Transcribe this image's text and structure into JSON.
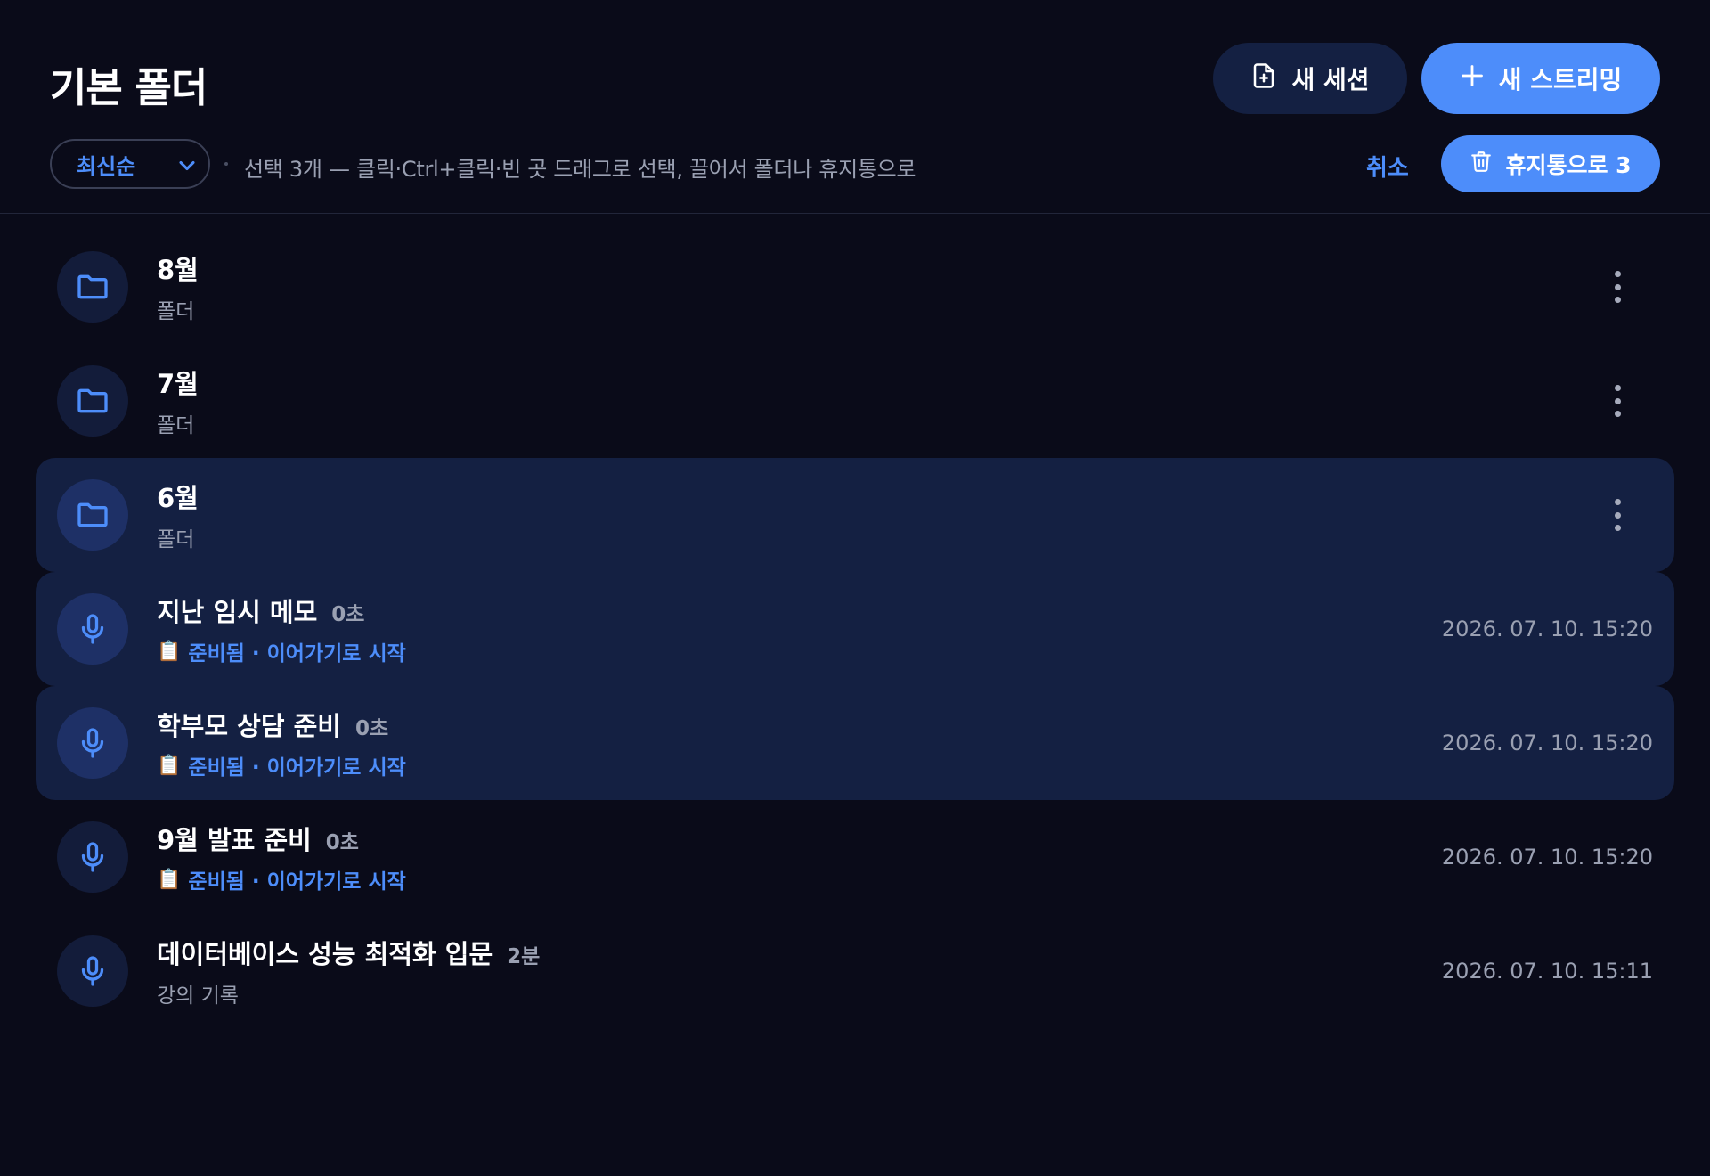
{
  "header": {
    "title": "기본 폴더",
    "new_session_label": "새 세션",
    "new_stream_label": "새 스트리밍"
  },
  "toolbar": {
    "sort_value": "최신순",
    "help_text": "선택 3개 — 클릭·Ctrl+클릭·빈 곳 드래그로 선택, 끌어서 폴더나 휴지통으로",
    "cancel_label": "취소",
    "trash_label": "휴지통으로 3"
  },
  "folders": [
    {
      "title": "8월",
      "subtitle": "폴더",
      "selected": false
    },
    {
      "title": "7월",
      "subtitle": "폴더",
      "selected": false
    },
    {
      "title": "6월",
      "subtitle": "폴더",
      "selected": true
    }
  ],
  "sessions": [
    {
      "title": "지난 임시 메모",
      "duration": "0초",
      "subtitle": "준비됨 · 이어가기로 시작",
      "status": true,
      "date": "2026. 07. 10. 15:20",
      "selected": true
    },
    {
      "title": "학부모 상담 준비",
      "duration": "0초",
      "subtitle": "준비됨 · 이어가기로 시작",
      "status": true,
      "date": "2026. 07. 10. 15:20",
      "selected": true
    },
    {
      "title": "9월 발표 준비",
      "duration": "0초",
      "subtitle": "준비됨 · 이어가기로 시작",
      "status": true,
      "date": "2026. 07. 10. 15:20",
      "selected": false
    },
    {
      "title": "데이터베이스 성능 최적화 입문",
      "duration": "2분",
      "subtitle": "강의 기록",
      "status": false,
      "date": "2026. 07. 10. 15:11",
      "selected": false
    }
  ],
  "colors": {
    "background": "#0a0b19",
    "accent": "#4d8dfa",
    "selected_row": "#142042",
    "muted_text": "#9aa0b2"
  },
  "icons": {
    "new_session": "file-plus-icon",
    "new_stream": "plus-icon",
    "trash": "trash-icon",
    "sort": "chevron-down-icon",
    "folder": "folder-icon",
    "session": "microphone-icon",
    "status": "clipboard-icon",
    "menu": "more-vertical-icon"
  }
}
